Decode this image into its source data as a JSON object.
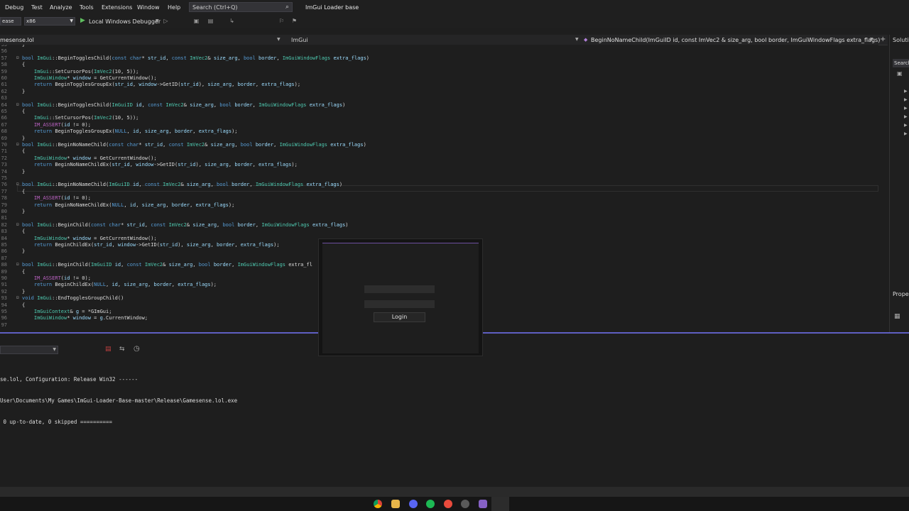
{
  "menu": {
    "items": [
      "Debug",
      "Test",
      "Analyze",
      "Tools",
      "Extensions",
      "Window",
      "Help"
    ]
  },
  "search": {
    "placeholder": "Search (Ctrl+Q)"
  },
  "app_title": "ImGui Loader base",
  "toolbar": {
    "config": "ease",
    "platform": "x86",
    "debugger": "Local Windows Debugger"
  },
  "editor": {
    "file_tab": "mesense.lol",
    "scope": "ImGui",
    "member": "BeginNoNameChild(ImGuiID id, const ImVec2 & size_arg, bool border, ImGuiWindowFlags extra_flags)"
  },
  "code_lines": [
    {
      "n": "55",
      "t": "}"
    },
    {
      "n": "56",
      "t": ""
    },
    {
      "n": "57",
      "t": "bool ImGui::BeginTogglesChild(const char* str_id, const ImVec2& size_arg, bool border, ImGuiWindowFlags extra_flags)"
    },
    {
      "n": "58",
      "t": "{"
    },
    {
      "n": "59",
      "t": "    ImGui::SetCursorPos(ImVec2(10, 5));"
    },
    {
      "n": "60",
      "t": "    ImGuiWindow* window = GetCurrentWindow();"
    },
    {
      "n": "61",
      "t": "    return BeginTogglesGroupEx(str_id, window->GetID(str_id), size_arg, border, extra_flags);"
    },
    {
      "n": "62",
      "t": "}"
    },
    {
      "n": "63",
      "t": ""
    },
    {
      "n": "64",
      "t": "bool ImGui::BeginTogglesChild(ImGuiID id, const ImVec2& size_arg, bool border, ImGuiWindowFlags extra_flags)"
    },
    {
      "n": "65",
      "t": "{"
    },
    {
      "n": "66",
      "t": "    ImGui::SetCursorPos(ImVec2(10, 5));"
    },
    {
      "n": "67",
      "t": "    IM_ASSERT(id != 0);"
    },
    {
      "n": "68",
      "t": "    return BeginTogglesGroupEx(NULL, id, size_arg, border, extra_flags);"
    },
    {
      "n": "69",
      "t": "}"
    },
    {
      "n": "70",
      "t": "bool ImGui::BeginNoNameChild(const char* str_id, const ImVec2& size_arg, bool border, ImGuiWindowFlags extra_flags)"
    },
    {
      "n": "71",
      "t": "{"
    },
    {
      "n": "72",
      "t": "    ImGuiWindow* window = GetCurrentWindow();"
    },
    {
      "n": "73",
      "t": "    return BeginNoNameChildEx(str_id, window->GetID(str_id), size_arg, border, extra_flags);"
    },
    {
      "n": "74",
      "t": "}"
    },
    {
      "n": "75",
      "t": ""
    },
    {
      "n": "76",
      "t": "bool ImGui::BeginNoNameChild(ImGuiID id, const ImVec2& size_arg, bool border, ImGuiWindowFlags extra_flags)"
    },
    {
      "n": "77",
      "t": "{"
    },
    {
      "n": "78",
      "t": "    IM_ASSERT(id != 0);"
    },
    {
      "n": "79",
      "t": "    return BeginNoNameChildEx(NULL, id, size_arg, border, extra_flags);"
    },
    {
      "n": "80",
      "t": "}"
    },
    {
      "n": "81",
      "t": ""
    },
    {
      "n": "82",
      "t": "bool ImGui::BeginChild(const char* str_id, const ImVec2& size_arg, bool border, ImGuiWindowFlags extra_flags)"
    },
    {
      "n": "83",
      "t": "{"
    },
    {
      "n": "84",
      "t": "    ImGuiWindow* window = GetCurrentWindow();"
    },
    {
      "n": "85",
      "t": "    return BeginChildEx(str_id, window->GetID(str_id), size_arg, border, extra_flags);"
    },
    {
      "n": "86",
      "t": "}"
    },
    {
      "n": "87",
      "t": ""
    },
    {
      "n": "88",
      "t": "bool ImGui::BeginChild(ImGuiID id, const ImVec2& size_arg, bool border, ImGuiWindowFlags extra_fl"
    },
    {
      "n": "89",
      "t": "{"
    },
    {
      "n": "90",
      "t": "    IM_ASSERT(id != 0);"
    },
    {
      "n": "91",
      "t": "    return BeginChildEx(NULL, id, size_arg, border, extra_flags);"
    },
    {
      "n": "92",
      "t": "}"
    },
    {
      "n": "93",
      "t": "void ImGui::EndTogglesGroupChild()"
    },
    {
      "n": "94",
      "t": "{"
    },
    {
      "n": "95",
      "t": "    ImGuiContext& g = *GImGui;"
    },
    {
      "n": "96",
      "t": "    ImGuiWindow* window = g.CurrentWindow;"
    },
    {
      "n": "97",
      "t": ""
    }
  ],
  "output_lines": [
    "se.lol, Configuration: Release Win32 ------",
    "User\\Documents\\My Games\\ImGui-Loader-Base-master\\Release\\Gamesense.lol.exe",
    " 0 up-to-date, 0 skipped =========="
  ],
  "side_panel": {
    "title": "Soluti",
    "search": "Search",
    "props": "Prope"
  },
  "login": {
    "button": "Login"
  },
  "colors": {
    "accent": "#6d4fa0",
    "divider": "#5f5fc2",
    "bg": "#1e1e1e"
  },
  "taskbar_icons": [
    "chrome-icon",
    "folder-icon",
    "discord-icon",
    "spotify-icon",
    "browser-icon",
    "settings-icon",
    "visual-studio-icon"
  ]
}
